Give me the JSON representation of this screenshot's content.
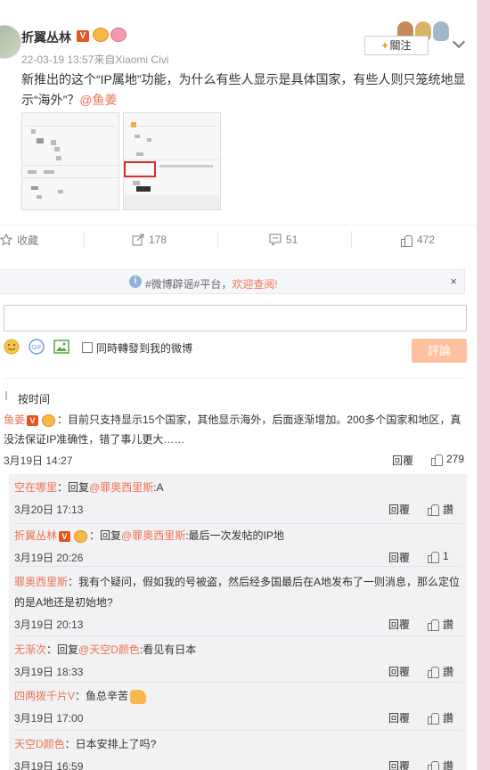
{
  "post": {
    "author": "折翼丛林",
    "verified_badge": "V",
    "meta": "22-03-19 13:57来自Xiaomi Civi",
    "follow_label": "關注",
    "text_main": "新推出的这个“IP属地”功能，为什么有些人显示是具体国家，有些人则只笼统地显示“海外”？",
    "text_mention": "@鱼姜",
    "thumb_labels": {
      "a": [
        "微博IP属地",
        "IP属地",
        "网易号",
        "登录账号",
        "收藏数",
        "微博问",
        "个人设置"
      ],
      "b": [
        "IP属地",
        "IP属地",
        "海外",
        "海外"
      ]
    }
  },
  "actions": {
    "favorite": "收藏",
    "repost_count": "178",
    "comment_count": "51",
    "like_count": "472"
  },
  "rumor_bar": {
    "text": "#微博辟谣#平台，",
    "link": "欢迎查阅!",
    "close": "×"
  },
  "compose": {
    "placeholder": "",
    "repost_label": "同時轉發到我的微博",
    "submit_label": "評論"
  },
  "sort_label": "按时间",
  "main_comment": {
    "name": "鱼姜",
    "badge": "V",
    "text": "：目前只支持显示15个国家，其他显示海外，后面逐渐增加。200多个国家和地区，真没法保证IP准确性，错了事儿更大……",
    "time": "3月19日 14:27",
    "reply": "回覆",
    "likes": "279"
  },
  "replies": [
    {
      "name": "空在哪里",
      "prefix": "：回复",
      "target": "@罪奥西里斯",
      "text": ":A",
      "time": "3月20日 17:13",
      "reply": "回覆",
      "likes": "讚",
      "badges": false,
      "hand": false
    },
    {
      "name": "折翼丛林",
      "prefix": "：回复",
      "target": "@罪奥西里斯",
      "text": ":最后一次发帖的IP地",
      "time": "3月19日 20:26",
      "reply": "回覆",
      "likes": "1",
      "badges": true,
      "hand": false
    },
    {
      "name": "罪奥西里斯",
      "prefix": "：我有个疑问，假如我的号被盗，然后经多国最后在A地发布了一则消息，那么定位的是A地还是初始地?",
      "target": "",
      "text": "",
      "time": "3月19日 20:13",
      "reply": "回覆",
      "likes": "讚",
      "badges": false,
      "hand": false
    },
    {
      "name": "无渐次",
      "prefix": "：回复",
      "target": "@天空D颜色",
      "text": ":看见有日本",
      "time": "3月19日 18:33",
      "reply": "回覆",
      "likes": "讚",
      "badges": false,
      "hand": false
    },
    {
      "name": "四两拨千片V",
      "prefix": "：鱼总辛苦",
      "target": "",
      "text": "",
      "time": "3月19日 17:00",
      "reply": "回覆",
      "likes": "讚",
      "badges": false,
      "hand": true
    },
    {
      "name": "天空D颜色",
      "prefix": "：日本安排上了吗?",
      "target": "",
      "text": "",
      "time": "3月19日 16:59",
      "reply": "回覆",
      "likes": "讚",
      "badges": false,
      "hand": false
    }
  ],
  "colors": {
    "accent": "#eb7350",
    "brand_orange": "#ff8200",
    "submit_disabled": "#ffc09f",
    "subcomment_bg": "#f2f2f5",
    "page_bg": "#f2b7c9"
  }
}
